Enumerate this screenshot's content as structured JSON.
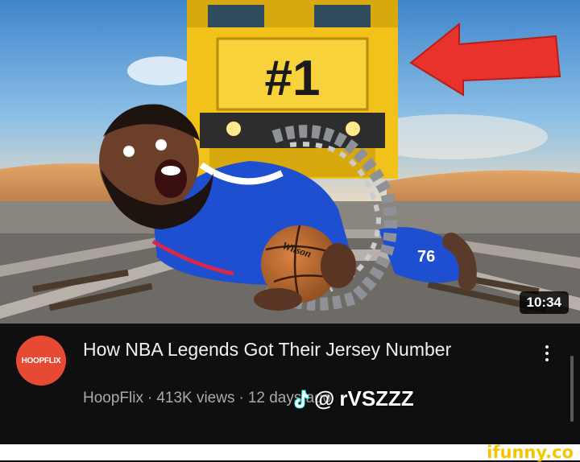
{
  "video": {
    "duration": "10:34",
    "thumbnail_text": "#1",
    "jersey_number": "76",
    "ball_brand": "Wilson",
    "title": "How NBA Legends Got Their Jersey Number",
    "channel_avatar": "HOOPFLIX",
    "channel": "HoopFlix",
    "views": "413K views",
    "age": "12 days ago",
    "separator": "·"
  },
  "overlay": {
    "tiktok_icon": "tiktok-note-icon",
    "at": "@",
    "handle": "rVSZZZ"
  },
  "footer": {
    "watermark": "ifunny.co"
  },
  "colors": {
    "train": "#f2c21b",
    "arrow": "#e8322b",
    "avatar": "#e64a33",
    "jersey": "#1f4fd1",
    "sky": "#4e8fd0",
    "sand": "#d99a5a"
  }
}
